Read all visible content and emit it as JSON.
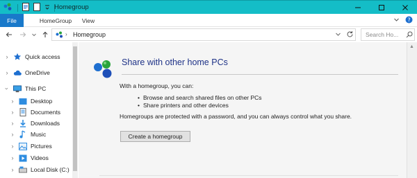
{
  "window": {
    "title": "Homegroup",
    "accent": "#14bdc7"
  },
  "ribbon": {
    "tabs": [
      {
        "label": "File"
      },
      {
        "label": "HomeGroup"
      },
      {
        "label": "View"
      }
    ]
  },
  "address": {
    "path": "Homegroup",
    "search_placeholder": "Search Ho..."
  },
  "nav": {
    "items": [
      {
        "label": "Quick access",
        "icon": "star-icon"
      },
      {
        "label": "OneDrive",
        "icon": "cloud-icon"
      },
      {
        "label": "This PC",
        "icon": "computer-icon"
      },
      {
        "label": "Desktop",
        "icon": "desktop-folder-icon"
      },
      {
        "label": "Documents",
        "icon": "documents-icon"
      },
      {
        "label": "Downloads",
        "icon": "download-icon"
      },
      {
        "label": "Music",
        "icon": "music-icon"
      },
      {
        "label": "Pictures",
        "icon": "pictures-icon"
      },
      {
        "label": "Videos",
        "icon": "videos-icon"
      },
      {
        "label": "Local Disk (C:)",
        "icon": "disk-icon"
      }
    ]
  },
  "main": {
    "title": "Share with other home PCs",
    "intro": "With a homegroup, you can:",
    "bullets": [
      "Browse and search shared files on other PCs",
      "Share printers and other devices"
    ],
    "note": "Homegroups are protected with a password, and you can always control what you share.",
    "create_button": "Create a homegroup"
  }
}
